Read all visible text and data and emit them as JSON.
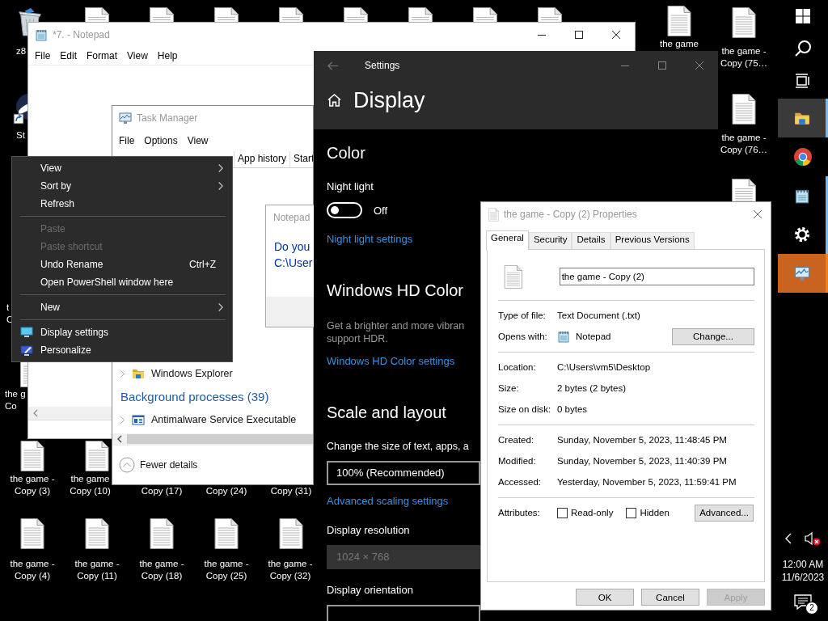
{
  "desktop": {
    "icons": [
      {
        "kind": "recycle_bin",
        "label": "z8"
      },
      {
        "kind": "file"
      },
      {
        "kind": "file"
      },
      {
        "kind": "file"
      },
      {
        "kind": "file"
      },
      {
        "kind": "file"
      },
      {
        "kind": "file"
      },
      {
        "kind": "file"
      },
      {
        "kind": "file"
      },
      {
        "kind": "file",
        "label": "the game"
      },
      {
        "kind": "file",
        "label": "the game - Copy (75…"
      },
      {
        "kind": "shortcut",
        "label": "St"
      },
      {
        "kind": "file",
        "label": "the game - Copy (76…"
      },
      {
        "kind": "file"
      },
      {
        "kind": "covered",
        "label": "t C"
      },
      {
        "kind": "file",
        "label": "the g Co"
      },
      {
        "kind": "file",
        "label": "the game - Copy (3)"
      },
      {
        "kind": "file",
        "label": "the game Copy (10)"
      },
      {
        "kind": "covered",
        "label": "Copy (17)"
      },
      {
        "kind": "covered",
        "label": "Copy (24)"
      },
      {
        "kind": "covered",
        "label": "Copy (31)"
      },
      {
        "kind": "file",
        "label": "the game - Copy (4)"
      },
      {
        "kind": "file",
        "label": "the game - Copy (11)"
      },
      {
        "kind": "file",
        "label": "the game - Copy (18)"
      },
      {
        "kind": "file",
        "label": "the game - Copy (25)"
      },
      {
        "kind": "file",
        "label": "the game - Copy (32)"
      }
    ]
  },
  "notepad": {
    "title": "*7. - Notepad",
    "active": false,
    "menu": [
      "File",
      "Edit",
      "Format",
      "View",
      "Help"
    ]
  },
  "task_manager": {
    "title": "Task Manager",
    "active": false,
    "menu": [
      "File",
      "Options",
      "View"
    ],
    "tabs": [
      {
        "label": "App history",
        "selected": false
      },
      {
        "label": "Start",
        "selected": false
      }
    ],
    "rows": [
      {
        "kind": "app",
        "name": "Windows Explorer"
      },
      {
        "kind": "group",
        "name": "Background processes (39)"
      },
      {
        "kind": "service",
        "name": "Antimalware Service Executable"
      }
    ],
    "footer": "Fewer details"
  },
  "notepad_dialog": {
    "title": "Notepad",
    "message_lines": [
      "Do you",
      "C:\\User"
    ]
  },
  "context_menu": {
    "items": [
      {
        "kind": "item",
        "label": "View",
        "submenu": true,
        "disabled": false
      },
      {
        "kind": "item",
        "label": "Sort by",
        "submenu": true,
        "disabled": false
      },
      {
        "kind": "item",
        "label": "Refresh",
        "submenu": false,
        "disabled": false
      },
      {
        "kind": "separator"
      },
      {
        "kind": "item",
        "label": "Paste",
        "submenu": false,
        "disabled": true
      },
      {
        "kind": "item",
        "label": "Paste shortcut",
        "submenu": false,
        "disabled": true
      },
      {
        "kind": "item",
        "label": "Undo Rename",
        "shortcut": "Ctrl+Z",
        "submenu": false,
        "disabled": false
      },
      {
        "kind": "item",
        "label": "Open PowerShell window here",
        "submenu": false,
        "disabled": false
      },
      {
        "kind": "separator"
      },
      {
        "kind": "item",
        "label": "New",
        "submenu": true,
        "disabled": false
      },
      {
        "kind": "separator"
      },
      {
        "kind": "display",
        "label": "Display settings",
        "submenu": false,
        "disabled": false
      },
      {
        "kind": "personalize",
        "label": "Personalize",
        "submenu": false,
        "disabled": false
      }
    ]
  },
  "settings": {
    "title": "Settings",
    "heading": "Display",
    "items": [
      {
        "kind": "heading",
        "text": "Color"
      },
      {
        "kind": "label",
        "text": "Night light"
      },
      {
        "kind": "toggle",
        "on": false,
        "text": "Off"
      },
      {
        "kind": "link",
        "text": "Night light settings"
      },
      {
        "kind": "heading",
        "text": "Windows HD Color"
      },
      {
        "kind": "paragraph",
        "lines": [
          "Get a brighter and more vibran",
          "support HDR."
        ]
      },
      {
        "kind": "link",
        "text": "Windows HD Color settings"
      },
      {
        "kind": "heading",
        "text": "Scale and layout"
      },
      {
        "kind": "label",
        "text": "Change the size of text, apps, a"
      },
      {
        "kind": "dropdown",
        "value": "100% (Recommended)",
        "disabled": false
      },
      {
        "kind": "link",
        "text": "Advanced scaling settings"
      },
      {
        "kind": "label",
        "text": "Display resolution"
      },
      {
        "kind": "dropdown",
        "value": "1024 × 768",
        "disabled": true
      },
      {
        "kind": "label",
        "text": "Display orientation"
      },
      {
        "kind": "dropdown",
        "disabled": false
      }
    ]
  },
  "properties": {
    "title": "the game - Copy (2) Properties",
    "tabs": [
      {
        "label": "General",
        "selected": true
      },
      {
        "label": "Security",
        "selected": false
      },
      {
        "label": "Details",
        "selected": false
      },
      {
        "label": "Previous Versions",
        "selected": false
      }
    ],
    "file_name": "the game - Copy (2)",
    "groups": [
      [
        {
          "kind": "text",
          "label": "Type of file:",
          "value": "Text Document (.txt)"
        },
        {
          "kind": "app",
          "label": "Opens with:",
          "value": "Notepad",
          "button": "Change..."
        }
      ],
      [
        {
          "kind": "text",
          "label": "Location:",
          "value": "C:\\Users\\vm5\\Desktop"
        },
        {
          "kind": "text",
          "label": "Size:",
          "value": "2 bytes (2 bytes)"
        },
        {
          "kind": "text",
          "label": "Size on disk:",
          "value": "0 bytes"
        }
      ],
      [
        {
          "kind": "text",
          "label": "Created:",
          "value": "Sunday, November 5, 2023, 11:48:45 PM"
        },
        {
          "kind": "text",
          "label": "Modified:",
          "value": "Sunday, November 5, 2023, 11:40:39 PM"
        },
        {
          "kind": "text",
          "label": "Accessed:",
          "value": "Yesterday, November 5, 2023, 11:59:41 PM"
        }
      ],
      [
        {
          "kind": "attributes",
          "label": "Attributes:",
          "checkboxes": [
            {
              "label": "Read-only",
              "checked": false
            },
            {
              "label": "Hidden",
              "checked": false
            }
          ],
          "button": "Advanced..."
        }
      ]
    ],
    "buttons": [
      {
        "label": "OK",
        "disabled": false
      },
      {
        "label": "Cancel",
        "disabled": false
      },
      {
        "label": "Apply",
        "disabled": true
      }
    ]
  },
  "taskbar": {
    "items": [
      {
        "kind": "start"
      },
      {
        "kind": "search"
      },
      {
        "kind": "task_view"
      },
      {
        "kind": "folder",
        "hovered": true,
        "flashing": false,
        "running": true
      },
      {
        "kind": "browser",
        "running": false
      },
      {
        "kind": "notepad",
        "running": true
      },
      {
        "kind": "gear",
        "running": true
      },
      {
        "kind": "monitor",
        "hovered": false,
        "flashing": true,
        "running": true
      }
    ],
    "tray": {
      "volume_muted": true,
      "time": "12:00 AM",
      "date": "11/6/2023",
      "notification_count": "2"
    }
  }
}
